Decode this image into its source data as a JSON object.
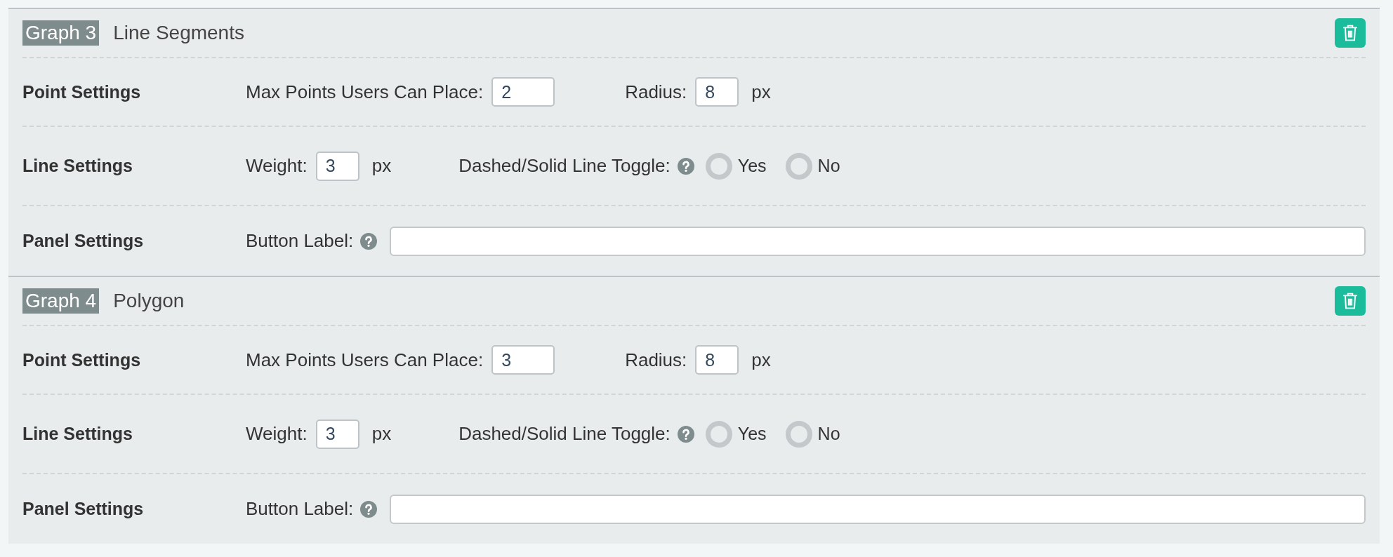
{
  "graphs": [
    {
      "badge": "Graph 3",
      "title": "Line Segments",
      "rows": [
        {
          "label": "Point Settings",
          "items": [
            {
              "kind": "label",
              "text": "Max Points Users Can Place:"
            },
            {
              "kind": "wide_input",
              "value": "2"
            },
            {
              "kind": "label",
              "text": "Radius:"
            },
            {
              "kind": "input",
              "value": "8"
            },
            {
              "kind": "unit",
              "text": "px"
            }
          ]
        },
        {
          "label": "Line Settings",
          "items": [
            {
              "kind": "label",
              "text": "Weight:"
            },
            {
              "kind": "input",
              "value": "3"
            },
            {
              "kind": "unit",
              "text": "px"
            },
            {
              "kind": "label",
              "text": "Dashed/Solid Line Toggle:"
            },
            {
              "kind": "help"
            },
            {
              "kind": "radio",
              "text": "Yes",
              "selected": false
            },
            {
              "kind": "radio",
              "text": "No",
              "selected": false
            }
          ]
        },
        {
          "label": "Panel Settings",
          "items": [
            {
              "kind": "label",
              "text": "Button Label:"
            },
            {
              "kind": "help"
            },
            {
              "kind": "text_field"
            }
          ]
        }
      ]
    },
    {
      "badge": "Graph 4",
      "title": "Polygon",
      "rows": [
        {
          "label": "Point Settings",
          "items": [
            {
              "kind": "label",
              "text": "Max Points Users Can Place:"
            },
            {
              "kind": "wide_input",
              "value": "3"
            },
            {
              "kind": "label",
              "text": "Radius:"
            },
            {
              "kind": "input",
              "value": "8"
            },
            {
              "kind": "unit",
              "text": "px"
            }
          ]
        },
        {
          "label": "Line Settings",
          "items": [
            {
              "kind": "label",
              "text": "Weight:"
            },
            {
              "kind": "input",
              "value": "3"
            },
            {
              "kind": "unit",
              "text": "px"
            },
            {
              "kind": "label",
              "text": "Dashed/Solid Line Toggle:"
            },
            {
              "kind": "help"
            },
            {
              "kind": "radio",
              "text": "Yes",
              "selected": false
            },
            {
              "kind": "radio",
              "text": "No",
              "selected": false
            }
          ]
        },
        {
          "label": "Panel Settings",
          "items": [
            {
              "kind": "label",
              "text": "Button Label:"
            },
            {
              "kind": "help"
            },
            {
              "kind": "text_field"
            }
          ]
        }
      ]
    }
  ]
}
